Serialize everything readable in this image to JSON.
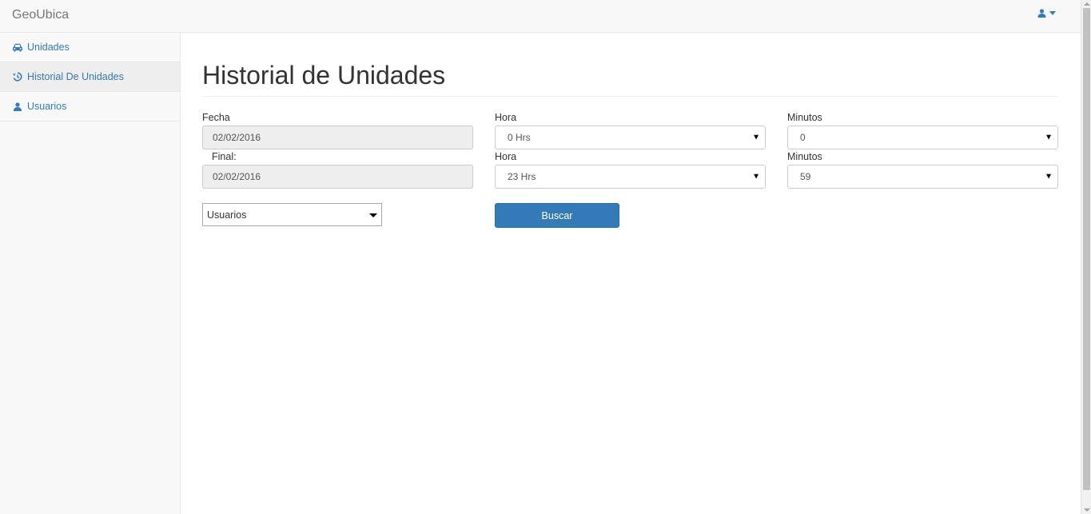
{
  "navbar": {
    "brand": "GeoUbica",
    "user_icon": "user-icon",
    "caret_icon": "caret-down-icon"
  },
  "sidebar": {
    "items": [
      {
        "label": "Unidades",
        "icon": "car-icon",
        "active": false
      },
      {
        "label": "Historial De Unidades",
        "icon": "history-icon",
        "active": true
      },
      {
        "label": "Usuarios",
        "icon": "user-icon",
        "active": false
      }
    ]
  },
  "main": {
    "title": "Historial de Unidades",
    "form": {
      "fecha_label": "Fecha",
      "fecha_value": "02/02/2016",
      "final_label": "Final:",
      "final_value": "02/02/2016",
      "hora_start_label": "Hora",
      "hora_start_value": "0 Hrs",
      "hora_end_label": "Hora",
      "hora_end_value": "23 Hrs",
      "min_start_label": "Minutos",
      "min_start_value": "0",
      "min_end_label": "Minutos",
      "min_end_value": "59",
      "usuarios_value": "Usuarios",
      "buscar_label": "Buscar"
    }
  },
  "colors": {
    "accent": "#337ab7",
    "navbar_bg": "#f8f8f8",
    "active_item_bg": "#eeeeee"
  }
}
